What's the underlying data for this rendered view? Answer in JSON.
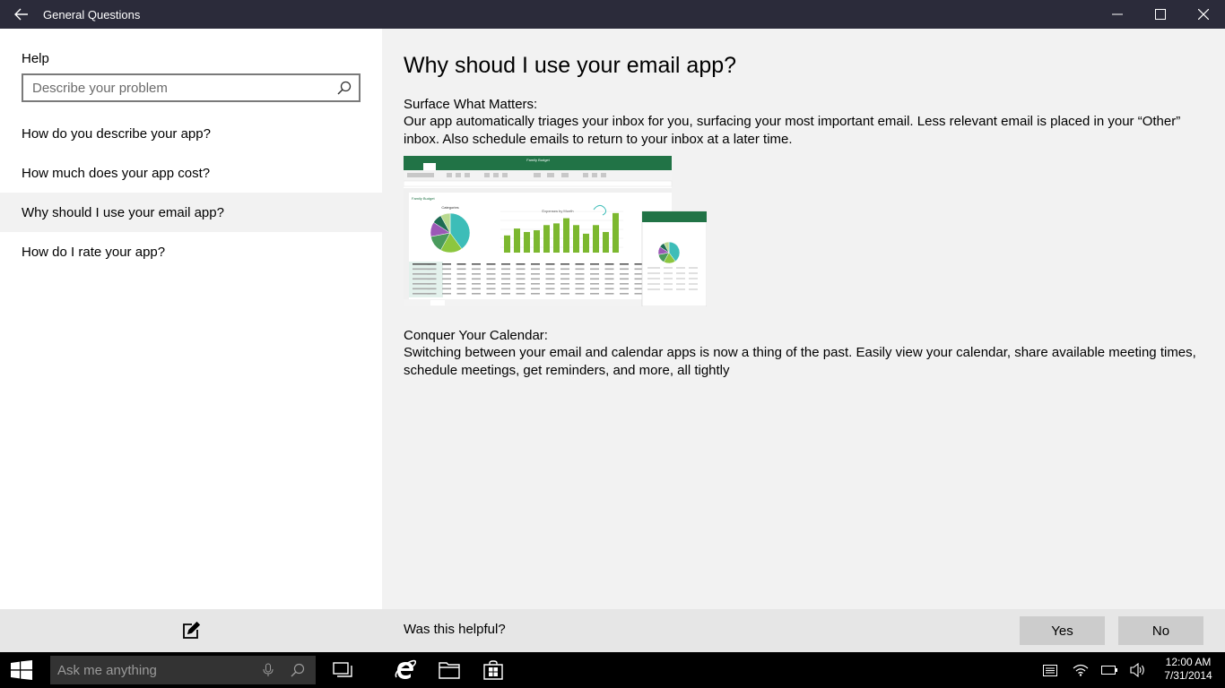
{
  "window": {
    "title": "General Questions",
    "back_icon": "arrow-left-icon",
    "minimize_icon": "minimize-icon",
    "maximize_icon": "maximize-icon",
    "close_icon": "close-icon"
  },
  "sidebar": {
    "help_label": "Help",
    "search_placeholder": "Describe your problem",
    "search_icon": "search-icon",
    "items": [
      {
        "label": "How do you describe your app?",
        "selected": false
      },
      {
        "label": "How much does your app cost?",
        "selected": false
      },
      {
        "label": "Why should I use your email app?",
        "selected": true
      },
      {
        "label": "How do I rate your app?",
        "selected": false
      }
    ],
    "footer_icon": "compose-icon"
  },
  "article": {
    "heading": "Why shoud I use your email app?",
    "sections": [
      {
        "title": "Surface What Matters:",
        "body": "Our app automatically triages your inbox for you, surfacing your most important email. Less relevant email is placed in your “Other” inbox. Also schedule emails to return to your inbox at a later time."
      },
      {
        "title": "Conquer Your Calendar:",
        "body": "Switching between your email and calendar apps is now a thing of the past. Easily view your calendar, share available meeting times, schedule meetings, get reminders, and more, all tightly"
      }
    ],
    "image": {
      "sheet_title": "Family Budget",
      "pie_title": "Categories",
      "bar_title": "Expenses by Month",
      "bar_values": [
        10,
        14,
        12,
        13,
        16,
        17,
        20,
        16,
        11,
        16,
        12,
        23
      ],
      "pie_slices": [
        {
          "value": 40,
          "color": "#3dbdb8"
        },
        {
          "value": 18,
          "color": "#8cc63f"
        },
        {
          "value": 14,
          "color": "#4a9b5c"
        },
        {
          "value": 12,
          "color": "#9b59b6"
        },
        {
          "value": 8,
          "color": "#1e6b52"
        },
        {
          "value": 8,
          "color": "#b8d98f"
        }
      ],
      "accent": "#217346"
    }
  },
  "feedback": {
    "question": "Was this helpful?",
    "yes": "Yes",
    "no": "No"
  },
  "taskbar": {
    "start_icon": "windows-logo-icon",
    "search_placeholder": "Ask me anything",
    "mic_icon": "microphone-icon",
    "search_icon": "search-icon",
    "task_view_icon": "task-view-icon",
    "apps": [
      "internet-explorer-icon",
      "file-explorer-icon",
      "store-icon"
    ],
    "tray": [
      "action-center-icon",
      "wifi-icon",
      "battery-icon",
      "volume-icon"
    ],
    "time": "12:00 AM",
    "date": "7/31/2014"
  },
  "colors": {
    "titlebar": "#2b2b3a",
    "sidebar_bg": "#ffffff",
    "content_bg": "#f2f2f2",
    "footer_bg": "#e6e6e6",
    "button_bg": "#cccccc",
    "taskbar": "#000000"
  }
}
